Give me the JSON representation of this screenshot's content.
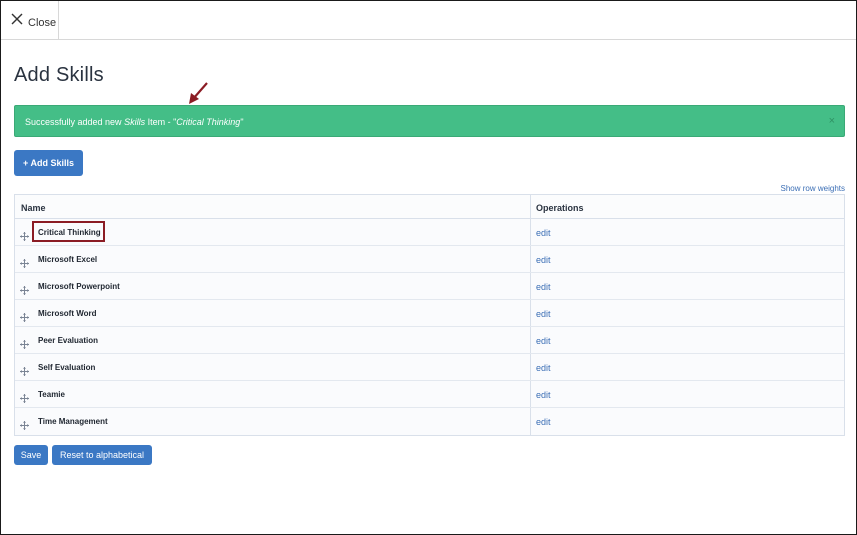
{
  "topbar": {
    "close_label": "Close"
  },
  "page": {
    "title": "Add Skills"
  },
  "alert": {
    "prefix": "Successfully added new ",
    "type": "Skills",
    "middle": " Item - \"",
    "item": "Critical Thinking",
    "suffix": "\"",
    "close": "×"
  },
  "buttons": {
    "add_skills": "+ Add Skills",
    "save": "Save",
    "reset": "Reset to alphabetical"
  },
  "table": {
    "show_row_weights": "Show row weights",
    "columns": {
      "name": "Name",
      "operations": "Operations"
    },
    "rows": [
      {
        "name": "Critical Thinking",
        "op": "edit"
      },
      {
        "name": "Microsoft Excel",
        "op": "edit"
      },
      {
        "name": "Microsoft Powerpoint",
        "op": "edit"
      },
      {
        "name": "Microsoft Word",
        "op": "edit"
      },
      {
        "name": "Peer Evaluation",
        "op": "edit"
      },
      {
        "name": "Self Evaluation",
        "op": "edit"
      },
      {
        "name": "Teamie",
        "op": "edit"
      },
      {
        "name": "Time Management",
        "op": "edit"
      }
    ]
  },
  "colors": {
    "alert_bg": "#44be87",
    "button_bg": "#3b78c4",
    "link": "#3b6eb5",
    "annotation": "#8b1c24"
  },
  "icons": {
    "close": "close-icon",
    "drag": "drag-handle-icon",
    "annotation_arrow": "arrow-icon"
  }
}
